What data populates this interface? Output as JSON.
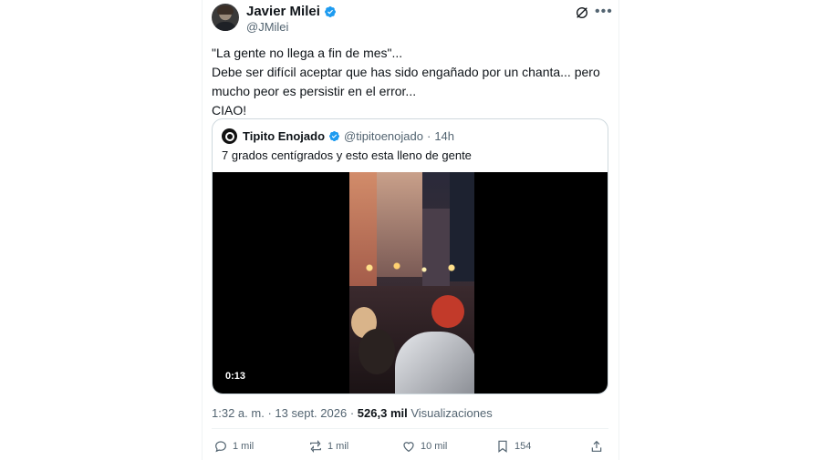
{
  "author": {
    "name": "Javier Milei",
    "handle": "@JMilei",
    "verified": true
  },
  "post": {
    "lines": [
      "\"La gente no llega a fin de mes\"...",
      "Debe ser difícil aceptar que has sido engañado por un chanta... pero",
      "mucho peor es persistir en el error...",
      "CIAO!"
    ]
  },
  "quote": {
    "name": "Tipito Enojado",
    "handle": "@tipitoenojado",
    "separator": "·",
    "age": "14h",
    "text": "7 grados centígrados y esto esta lleno de gente",
    "video_duration": "0:13"
  },
  "meta": {
    "time": "1:32 a. m.",
    "separator": "·",
    "date": "13 sept. 2026",
    "views_count": "526,3 mil",
    "views_label": "Visualizaciones"
  },
  "actions": {
    "replies": "1 mil",
    "reposts": "1 mil",
    "likes": "10 mil",
    "bookmarks": "154"
  },
  "icons": [
    "verified-badge-icon",
    "grok-icon",
    "more-icon",
    "reply-icon",
    "repost-icon",
    "like-icon",
    "bookmark-icon",
    "share-icon"
  ],
  "colors": {
    "verified": "#1d9bf0",
    "secondary_text": "#536471",
    "border": "#cfd9de"
  }
}
